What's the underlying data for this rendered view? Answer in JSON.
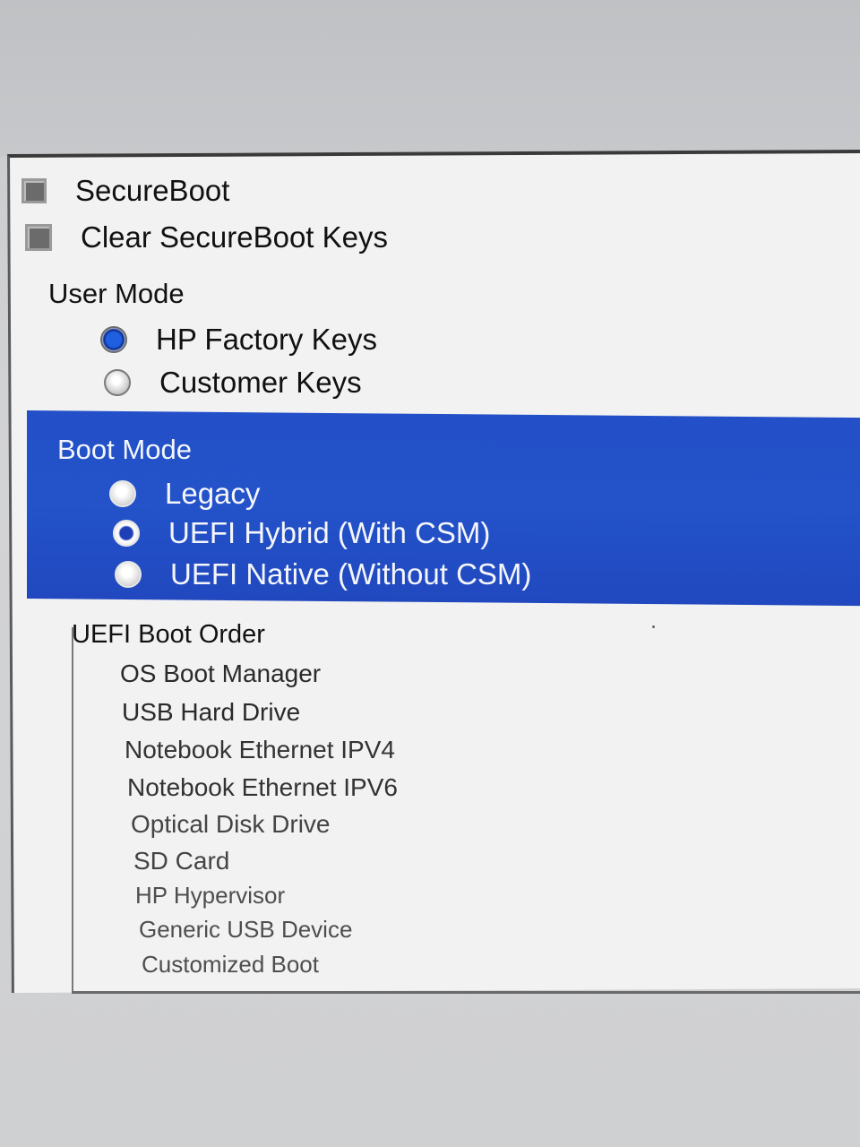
{
  "secureboot": {
    "checkbox_label": "SecureBoot",
    "clear_keys_label": "Clear SecureBoot Keys"
  },
  "user_mode": {
    "title": "User Mode",
    "options": [
      {
        "label": "HP Factory Keys",
        "selected": true
      },
      {
        "label": "Customer Keys",
        "selected": false
      }
    ]
  },
  "boot_mode": {
    "title": "Boot Mode",
    "highlight_color": "#2350c8",
    "options": [
      {
        "label": "Legacy",
        "selected": false
      },
      {
        "label": "UEFI Hybrid (With CSM)",
        "selected": false
      },
      {
        "label": "UEFI Native (Without CSM)",
        "selected": false
      }
    ]
  },
  "uefi_boot_order": {
    "title": "UEFI Boot Order",
    "items": [
      "OS Boot Manager",
      "USB Hard Drive",
      "Notebook Ethernet IPV4",
      "Notebook Ethernet IPV6",
      "Optical Disk Drive",
      "SD Card",
      "HP Hypervisor",
      "Generic USB Device",
      "Customized Boot"
    ]
  }
}
